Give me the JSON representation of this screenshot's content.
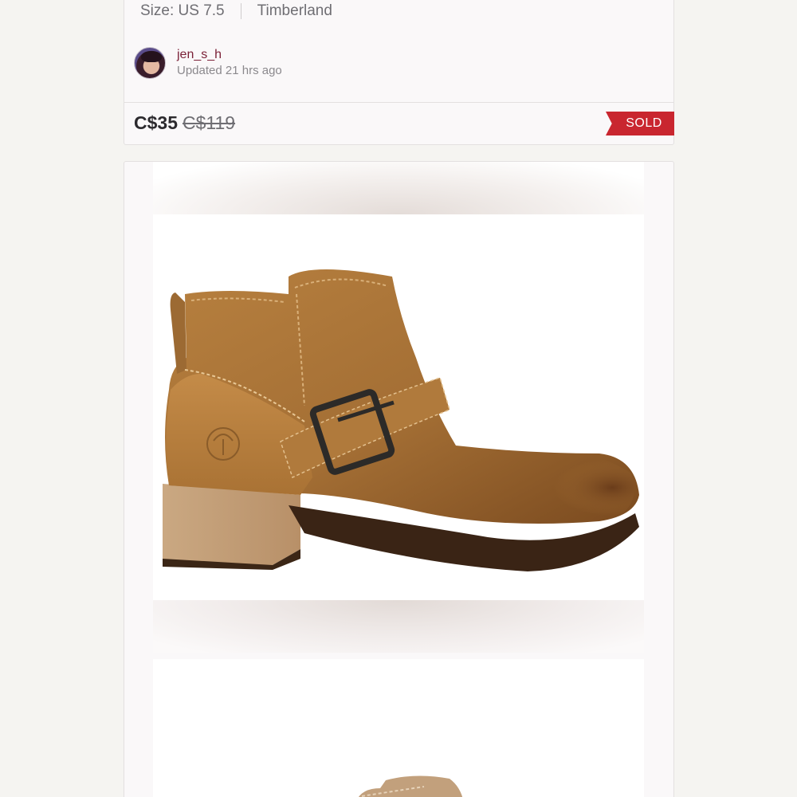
{
  "listing": {
    "size_label": "Size: US 7.5",
    "brand": "Timberland",
    "seller": {
      "username": "jen_s_h",
      "updated": "Updated 21 hrs ago"
    },
    "price": "C$35",
    "original_price": "C$119",
    "status_badge": "SOLD"
  },
  "colors": {
    "accent": "#c9262f",
    "username": "#7a1f36"
  },
  "images": [
    {
      "icon": "boot-photo",
      "subject": "Timberland tan leather ankle boot with buckle strap"
    },
    {
      "icon": "boot-photo-2",
      "subject": "second boot photo (partially visible)"
    }
  ]
}
